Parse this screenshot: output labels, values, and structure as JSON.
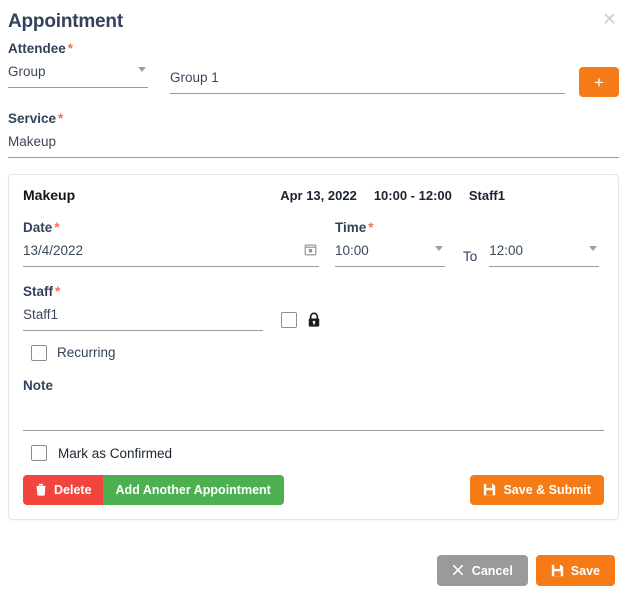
{
  "modal": {
    "title": "Appointment",
    "close_icon": "close-icon"
  },
  "attendee": {
    "label": "Attendee",
    "required_marker": "*",
    "type_value": "Group",
    "type_options": [
      "Group"
    ],
    "name_value": "Group 1",
    "add_label": "+"
  },
  "service": {
    "label": "Service",
    "required_marker": "*",
    "value": "Makeup"
  },
  "appointment_card": {
    "service_name": "Makeup",
    "summary": {
      "date": "Apr 13, 2022",
      "time_range": "10:00 - 12:00",
      "staff": "Staff1"
    },
    "date": {
      "label": "Date",
      "required_marker": "*",
      "value": "13/4/2022",
      "icon": "calendar-icon"
    },
    "time": {
      "label": "Time",
      "required_marker": "*",
      "from_value": "10:00",
      "to_separator": "To",
      "to_value": "12:00"
    },
    "staff": {
      "label": "Staff",
      "required_marker": "*",
      "value": "Staff1",
      "lock_icon": "lock-icon"
    },
    "recurring": {
      "label": "Recurring",
      "checked": false
    },
    "note": {
      "label": "Note",
      "value": "",
      "placeholder": ""
    },
    "mark_confirmed": {
      "label": "Mark as Confirmed",
      "checked": false
    },
    "actions": {
      "delete_label": "Delete",
      "add_another_label": "Add Another Appointment",
      "save_submit_label": "Save & Submit"
    }
  },
  "footer": {
    "cancel_label": "Cancel",
    "save_label": "Save"
  },
  "colors": {
    "accent_orange": "#f47b16",
    "danger_red": "#f2453d",
    "success_green": "#4caf50",
    "neutral_gray": "#9a9a9a",
    "required_red": "#ff6b5b",
    "text_navy": "#33425b"
  }
}
